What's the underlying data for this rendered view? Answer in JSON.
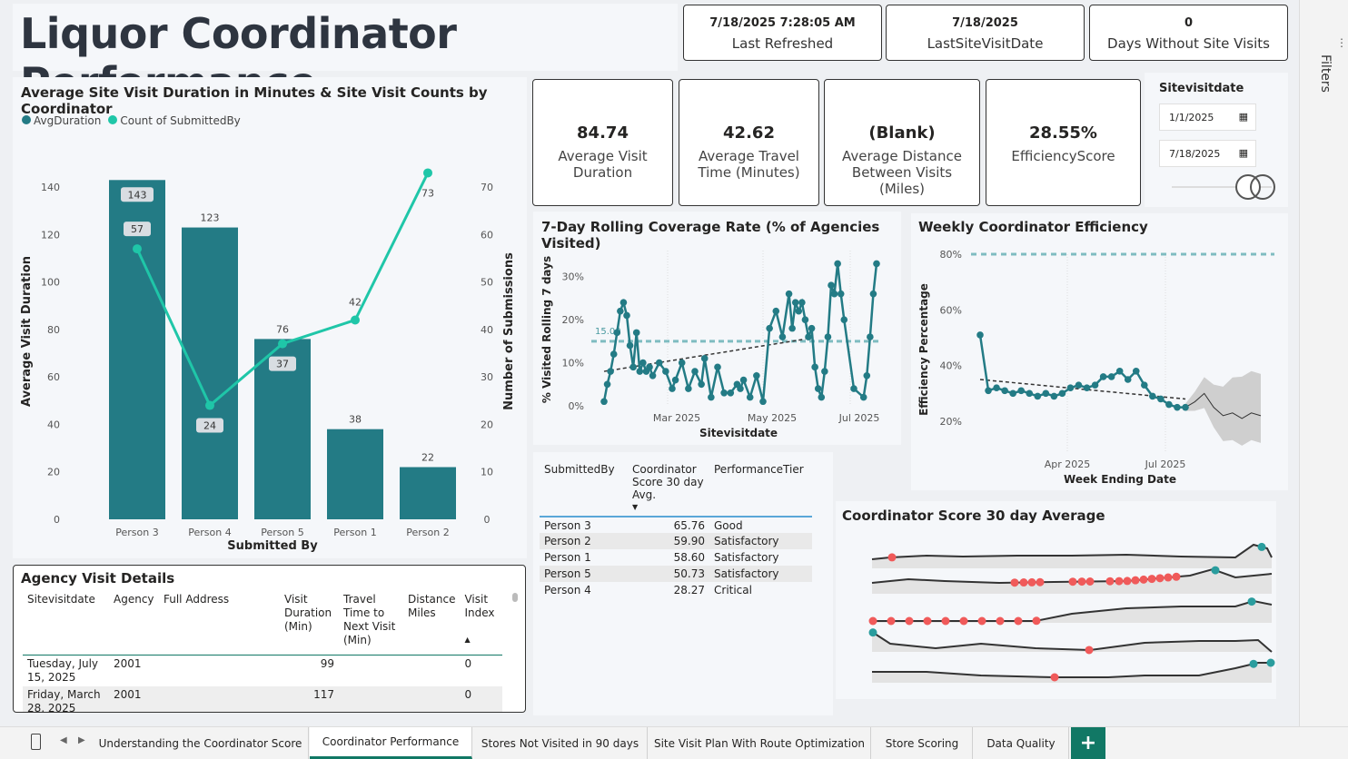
{
  "header": {
    "title": "Liquor Coordinator Performance",
    "cards": [
      {
        "value": "7/18/2025 7:28:05 AM",
        "label": "Last Refreshed"
      },
      {
        "value": "7/18/2025",
        "label": "LastSiteVisitDate"
      },
      {
        "value": "0",
        "label": "Days Without Site Visits"
      }
    ]
  },
  "kpis": [
    {
      "value": "84.74",
      "label": "Average Visit Duration"
    },
    {
      "value": "42.62",
      "label": "Average Travel Time (Minutes)"
    },
    {
      "value": "(Blank)",
      "label": "Average Distance Between Visits (Miles)"
    },
    {
      "value": "28.55%",
      "label": "EfficiencyScore"
    }
  ],
  "slicer": {
    "title": "Sitevisitdate",
    "start": "1/1/2025",
    "end": "7/18/2025"
  },
  "filters_label": "Filters",
  "colors": {
    "teal_dark": "#237b85",
    "teal_light": "#1fc6a8",
    "ref_line": "#7fbcc1",
    "red": "#f05a5a",
    "accent": "#117865"
  },
  "chart_data": [
    {
      "type": "bar",
      "title": "Average Site Visit Duration in Minutes & Site Visit Counts by Coordinator",
      "legend": [
        "AvgDuration",
        "Count of SubmittedBy"
      ],
      "legend_position": "top-left",
      "categories": [
        "Person 3",
        "Person 4",
        "Person 5",
        "Person 1",
        "Person 2"
      ],
      "series": [
        {
          "name": "AvgDuration",
          "values": [
            143,
            123,
            76,
            38,
            22
          ],
          "axis": "left"
        },
        {
          "name": "Count of SubmittedBy",
          "values": [
            57,
            24,
            37,
            42,
            73
          ],
          "axis": "right",
          "type": "line"
        }
      ],
      "xlabel": "Submitted By",
      "ylabel": "Average Visit Duration",
      "y2label": "Number of Submissions",
      "ylim": [
        0,
        150
      ],
      "y2lim": [
        0,
        75
      ],
      "yticks": [
        0,
        20,
        40,
        60,
        80,
        100,
        120,
        140
      ],
      "y2ticks": [
        0,
        10,
        20,
        30,
        40,
        50,
        60,
        70
      ]
    },
    {
      "type": "line",
      "title": "7-Day Rolling Coverage Rate (% of Agencies Visited)",
      "xlabel": "Sitevisitdate",
      "ylabel": "% Visited Rolling 7 days",
      "xticks": [
        "Mar 2025",
        "May 2025",
        "Jul 2025"
      ],
      "yticks": [
        "0%",
        "10%",
        "20%",
        "30%"
      ],
      "ylim": [
        0,
        35
      ],
      "reference_label": "15.00",
      "reference_value": 15,
      "trend": [
        [
          0,
          8
        ],
        [
          62,
          15.5
        ]
      ],
      "x_days": [
        0,
        1,
        2,
        3,
        4,
        5,
        6,
        7,
        8,
        9,
        10,
        11,
        12,
        13,
        14,
        15,
        17,
        19,
        21,
        22,
        24,
        26,
        28,
        30,
        31,
        33,
        35,
        37,
        39,
        41,
        42,
        43,
        45,
        47,
        49,
        51,
        53,
        55,
        57,
        58,
        59,
        60,
        61,
        62,
        63,
        64,
        65,
        66,
        67,
        68,
        69,
        70,
        71,
        72,
        73,
        74,
        77,
        80,
        81,
        82,
        83,
        84
      ],
      "values": [
        1,
        5,
        8,
        12,
        17,
        22,
        24,
        21,
        14,
        9,
        17,
        8,
        10,
        8,
        9,
        7,
        10,
        8,
        4,
        6,
        10,
        4,
        8,
        5,
        11,
        2,
        9,
        3,
        3,
        5,
        4,
        6,
        2,
        7,
        1,
        18,
        22,
        16,
        26,
        18,
        24,
        22,
        24,
        20,
        16,
        18,
        9,
        4,
        2,
        8,
        16,
        28,
        26,
        33,
        26,
        20,
        4,
        2,
        7,
        16,
        26,
        33
      ]
    },
    {
      "type": "line",
      "title": "Weekly Coordinator Efficiency",
      "xlabel": "Week Ending Date",
      "ylabel": "Efficiency Percentage",
      "xticks": [
        "Apr 2025",
        "Jul 2025"
      ],
      "yticks": [
        "20%",
        "40%",
        "60%",
        "80%"
      ],
      "ylim": [
        15,
        85
      ],
      "reference_value": 80,
      "values": [
        51,
        31,
        32,
        31,
        30,
        31,
        30,
        29,
        30,
        29,
        30,
        32,
        33,
        32,
        33,
        36,
        36,
        38,
        35,
        38,
        33,
        29,
        28,
        26,
        25,
        25
      ],
      "trend_start": 35,
      "trend_end": 28,
      "forecast": [
        27,
        30,
        25,
        22,
        23,
        21,
        23,
        22
      ]
    }
  ],
  "agency_table": {
    "title": "Agency Visit Details",
    "columns": [
      "Sitevisitdate",
      "Agency",
      "Full Address",
      "Visit Duration (Min)",
      "Travel Time to Next Visit (Min)",
      "Distance Miles",
      "Visit Index"
    ],
    "rows": [
      [
        "Tuesday, July 15, 2025",
        "2001",
        "",
        "99",
        "",
        "",
        "0"
      ],
      [
        "Friday, March 28, 2025",
        "2001",
        "",
        "117",
        "",
        "",
        "0"
      ]
    ]
  },
  "score_table": {
    "columns": [
      "SubmittedBy",
      "Coordinator Score 30 day Avg.",
      "PerformanceTier"
    ],
    "rows": [
      [
        "Person 3",
        "65.76",
        "Good"
      ],
      [
        "Person 2",
        "59.90",
        "Satisfactory"
      ],
      [
        "Person 1",
        "58.60",
        "Satisfactory"
      ],
      [
        "Person 5",
        "50.73",
        "Satisfactory"
      ],
      [
        "Person 4",
        "28.27",
        "Critical"
      ]
    ]
  },
  "sparklines": {
    "title": "Coordinator Score 30 day Average"
  },
  "tabs": [
    {
      "label": "Understanding the Coordinator Score",
      "active": false
    },
    {
      "label": "Coordinator Performance",
      "active": true
    },
    {
      "label": "Stores Not Visited in 90 days",
      "active": false
    },
    {
      "label": "Site Visit Plan With Route Optimization",
      "active": false
    },
    {
      "label": "Store Scoring",
      "active": false
    },
    {
      "label": "Data Quality",
      "active": false
    }
  ],
  "add_tab": "+"
}
